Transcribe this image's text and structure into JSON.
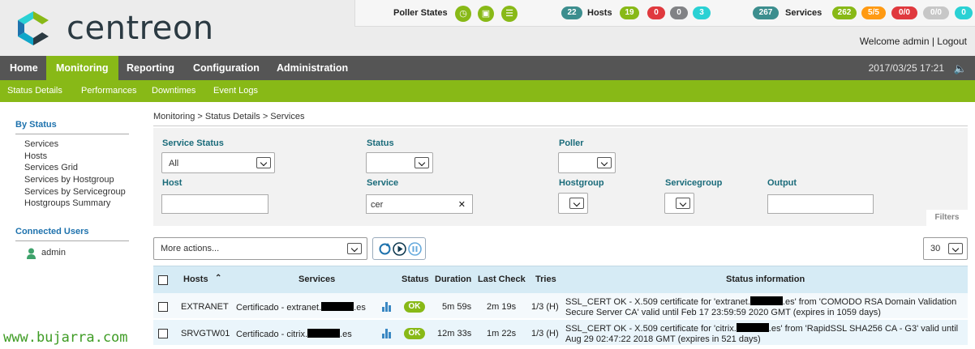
{
  "header": {
    "logo_text": "centreon",
    "poller_label": "Poller States",
    "hosts": {
      "label": "Hosts",
      "total": "22",
      "up": "19",
      "down": "0",
      "unreachable": "0",
      "pending": "3"
    },
    "services": {
      "label": "Services",
      "total": "267",
      "ok": "262",
      "warning": "5/5",
      "critical": "0/0",
      "unknown": "0/0",
      "pending": "0"
    },
    "welcome": "Welcome admin | Logout"
  },
  "nav": {
    "items": [
      "Home",
      "Monitoring",
      "Reporting",
      "Configuration",
      "Administration"
    ],
    "active": "Monitoring",
    "datetime": "2017/03/25 17:21"
  },
  "subnav": {
    "items": [
      "Status Details",
      "Performances",
      "Downtimes",
      "Event Logs"
    ]
  },
  "sidebar": {
    "by_status": "By Status",
    "links": [
      "Services",
      "Hosts",
      "Services Grid",
      "Services by Hostgroup",
      "Services by Servicegroup",
      "Hostgroups Summary"
    ],
    "connected_users": "Connected Users",
    "user": "admin"
  },
  "breadcrumb": "Monitoring  >  Status Details  >  Services",
  "filters": {
    "service_status_label": "Service Status",
    "service_status_value": "All",
    "status_label": "Status",
    "poller_label": "Poller",
    "host_label": "Host",
    "service_label": "Service",
    "service_value": "cer",
    "hostgroup_label": "Hostgroup",
    "servicegroup_label": "Servicegroup",
    "output_label": "Output",
    "tab_label": "Filters"
  },
  "actions": {
    "more_actions": "More actions...",
    "page_size": "30"
  },
  "table": {
    "columns": [
      "Hosts",
      "Services",
      "Status",
      "Duration",
      "Last Check",
      "Tries",
      "Status information"
    ],
    "rows": [
      {
        "host": "EXTRANET",
        "service_prefix": "Certificado - extranet.",
        "service_suffix": ".es",
        "status": "OK",
        "duration": "5m 59s",
        "last_check": "2m 19s",
        "tries": "1/3 (H)",
        "info_1a": "SSL_CERT OK - X.509 certificate for 'extranet.",
        "info_1b": ".es' from 'COMODO RSA Domain Validation",
        "info_2": "Secure Server CA' valid until Feb 17 23:59:59 2020 GMT (expires in 1059 days)"
      },
      {
        "host": "SRVGTW01",
        "service_prefix": "Certificado - citrix.",
        "service_suffix": ".es",
        "status": "OK",
        "duration": "12m 33s",
        "last_check": "1m 22s",
        "tries": "1/3 (H)",
        "info_1a": "SSL_CERT OK - X.509 certificate for 'citrix.",
        "info_1b": ".es' from 'RapidSSL SHA256 CA - G3' valid until",
        "info_2": "Aug 29 02:47:22 2018 GMT (expires in 521 days)"
      }
    ]
  },
  "watermark": "www.bujarra.com",
  "colors": {
    "green": "#88b917",
    "teal": "#3c8e8e",
    "red": "#e0393e",
    "grey": "#818285",
    "cyan": "#2ad1d4",
    "orange": "#ff9a13",
    "nav": "#555555"
  }
}
